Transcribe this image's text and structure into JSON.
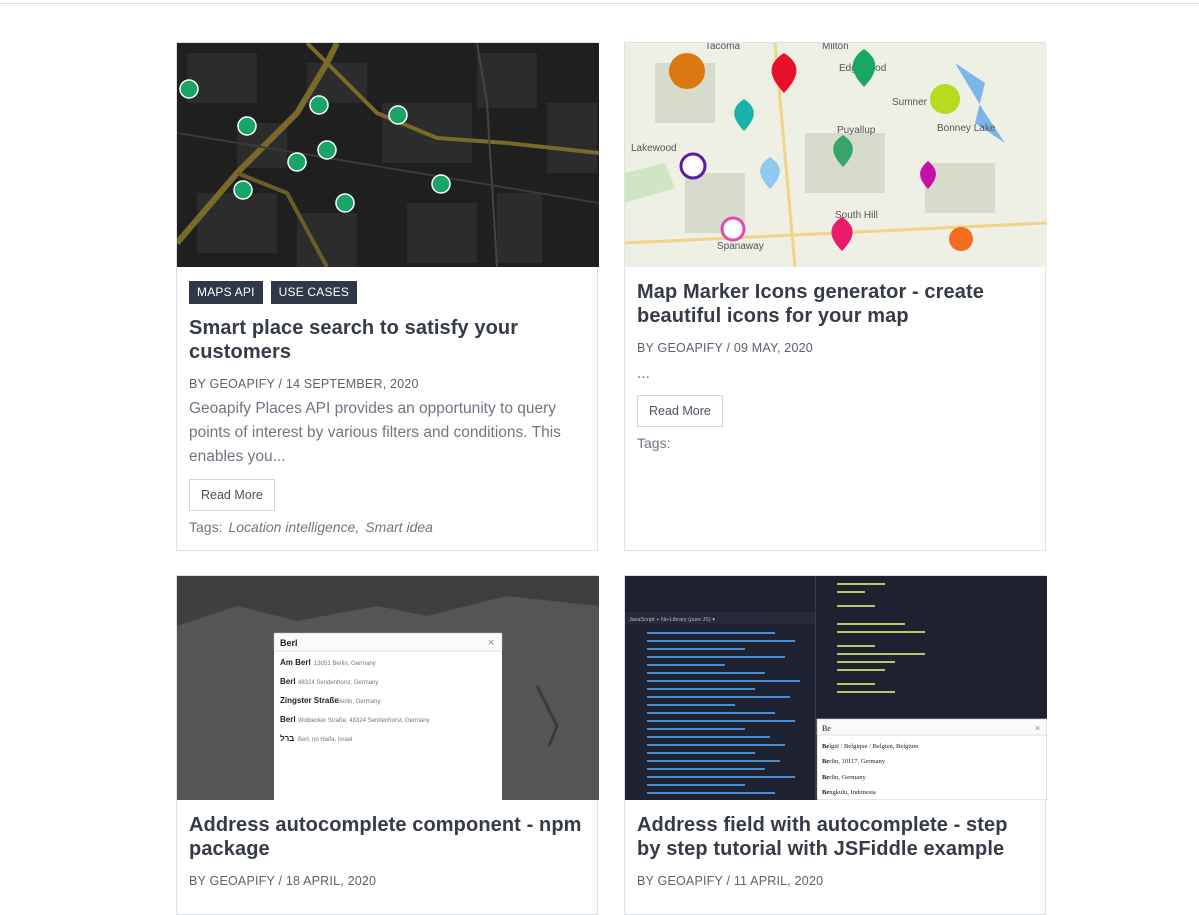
{
  "cards": [
    {
      "tags": [
        "MAPS API",
        "USE CASES"
      ],
      "title": "Smart place search to satisfy your customers",
      "meta": "BY GEOAPIFY / 14 SEPTEMBER, 2020",
      "excerpt": "Geoapify Places API provides an opportunity to query points of interest by various filters and conditions. This enables you...",
      "button": "Read More",
      "tags_label": "Tags:",
      "tag_links": [
        "Location intelligence,",
        "Smart idea"
      ]
    },
    {
      "title": "Map Marker Icons generator - create beautiful icons for your map",
      "meta": "BY GEOAPIFY / 09 MAY, 2020",
      "excerpt": "...",
      "button": "Read More",
      "tags_label": "Tags:",
      "map_labels": [
        "Tacoma",
        "Milton",
        "Edgewood",
        "Sumner",
        "Bonney Lake",
        "Puyallup",
        "Lakewood",
        "South Hill",
        "Spanaway"
      ]
    },
    {
      "title": "Address autocomplete component - npm package",
      "meta": "BY GEOAPIFY / 18 APRIL, 2020",
      "autocomplete": {
        "query": "Berl",
        "results": [
          {
            "bold": "Am Berl",
            "detail": "13051 Berlin, Germany"
          },
          {
            "bold": "Berl",
            "detail": "48324 Sendenhorst, Germany"
          },
          {
            "bold": "Zingster Straße",
            "detail": "Berlin, Germany"
          },
          {
            "bold": "Berl",
            "detail": "Wolbecker Straße, 48324 Sendenhorst, Germany"
          },
          {
            "bold": "ברל",
            "detail": "Berl, no Haifa, Israel"
          }
        ]
      }
    },
    {
      "title": "Address field with autocomplete - step by step tutorial with JSFiddle example",
      "meta": "BY GEOAPIFY / 11 APRIL, 2020",
      "autocomplete": {
        "query": "Be",
        "results": [
          {
            "bold": "Be",
            "detail": "lgië / Belgique / Belgien, Belgium"
          },
          {
            "bold": "Be",
            "detail": "rlin, 10117, Germany"
          },
          {
            "bold": "Be",
            "detail": "rlin, Germany"
          },
          {
            "bold": "Be",
            "detail": "ngkulu, Indonesia"
          }
        ]
      },
      "editor_label": "JavaScript + No-Library (pure JS) ▾"
    }
  ],
  "colors": {
    "tag_bg": "#2f3848",
    "title": "#353b47",
    "marker_green": "#18a567"
  }
}
